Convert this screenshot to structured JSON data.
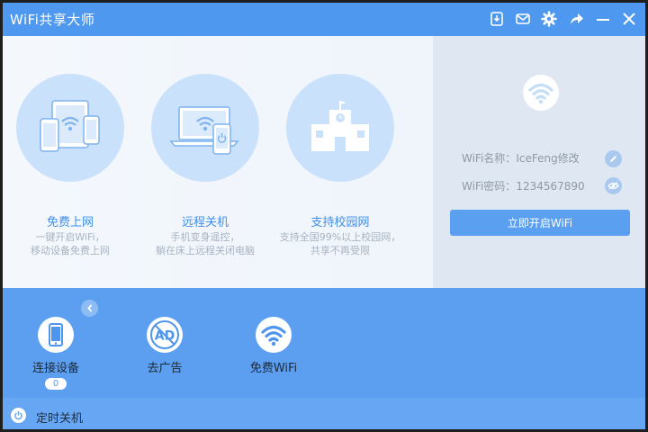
{
  "window": {
    "title": "WiFi共享大师"
  },
  "titlebar_buttons": [
    {
      "icon": "download-icon"
    },
    {
      "icon": "mail-icon"
    },
    {
      "icon": "gear-icon"
    },
    {
      "icon": "share-arrow-icon"
    },
    {
      "icon": "minimize-icon"
    },
    {
      "icon": "close-icon"
    }
  ],
  "features": [
    {
      "title": "免费上网",
      "desc1": "一键开启WiFi，",
      "desc2": "移动设备免费上网",
      "icon": "devices-wifi-icon"
    },
    {
      "title": "远程关机",
      "desc1": "手机变身遥控，",
      "desc2": "躺在床上远程关闭电脑",
      "icon": "laptop-phone-power-icon"
    },
    {
      "title": "支持校园网",
      "desc1": "支持全国99%以上校园网，",
      "desc2": "共享不再受限",
      "icon": "school-building-icon"
    }
  ],
  "side": {
    "name_label": "WiFi名称：",
    "name_value": "IceFeng修改",
    "password_label": "WiFi密码：",
    "password_value": "1234567890",
    "start_button": "立即开启WiFi"
  },
  "tools": [
    {
      "label": "连接设备",
      "badge": "0",
      "icon": "phone-icon"
    },
    {
      "label": "去广告",
      "icon": "ad-block-icon"
    },
    {
      "label": "免费WiFi",
      "icon": "wifi-icon"
    }
  ],
  "footer": {
    "label": "定时关机"
  },
  "colors": {
    "accent": "#4e98ef",
    "panel": "#5c9ef0",
    "circle": "#c9e1fb"
  }
}
